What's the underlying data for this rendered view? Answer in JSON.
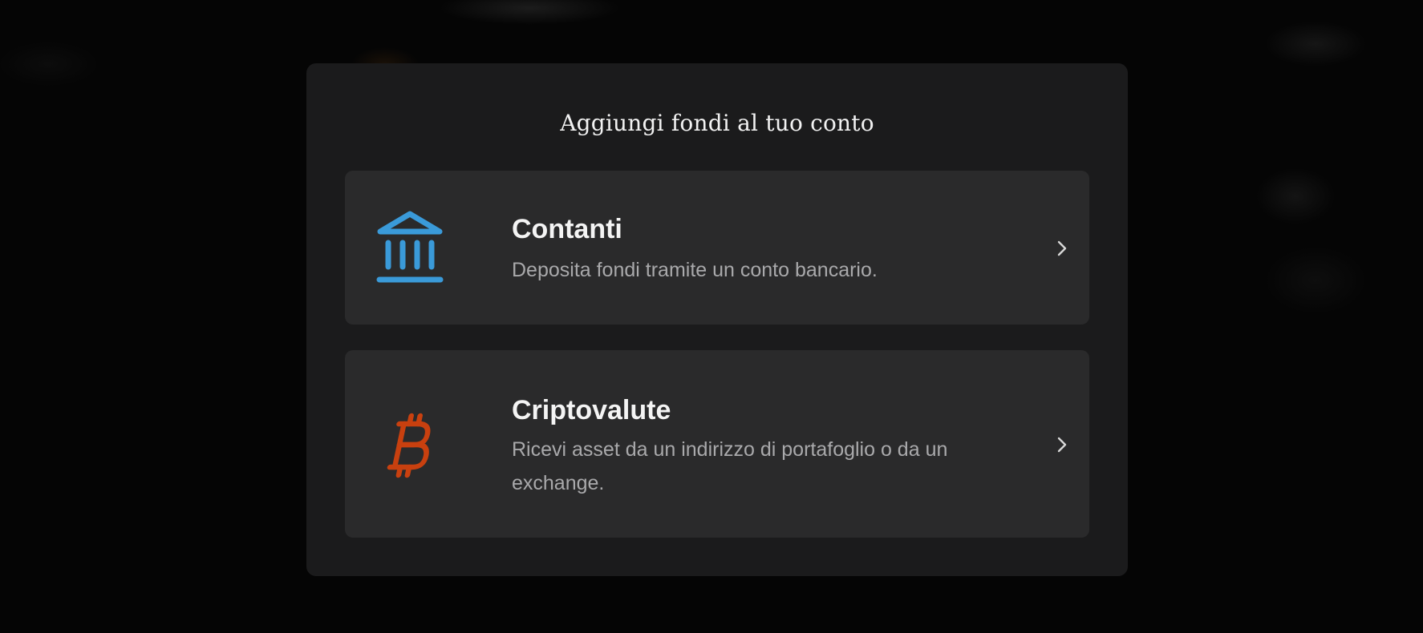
{
  "modal": {
    "title": "Aggiungi fondi al tuo conto"
  },
  "options": [
    {
      "title": "Contanti",
      "description": "Deposita fondi tramite un conto bancario.",
      "icon": "bank-icon",
      "icon_color": "#3a9ad9"
    },
    {
      "title": "Criptovalute",
      "description": "Ricevi asset da un indirizzo di portafoglio o da un exchange.",
      "icon": "bitcoin-icon",
      "icon_color": "#c8400f"
    }
  ],
  "colors": {
    "backdrop": "#050505",
    "modal_bg": "#1b1b1c",
    "option_bg": "#2a2a2b",
    "title_text": "#f4f4f4",
    "description_text": "#a9a9ab"
  }
}
